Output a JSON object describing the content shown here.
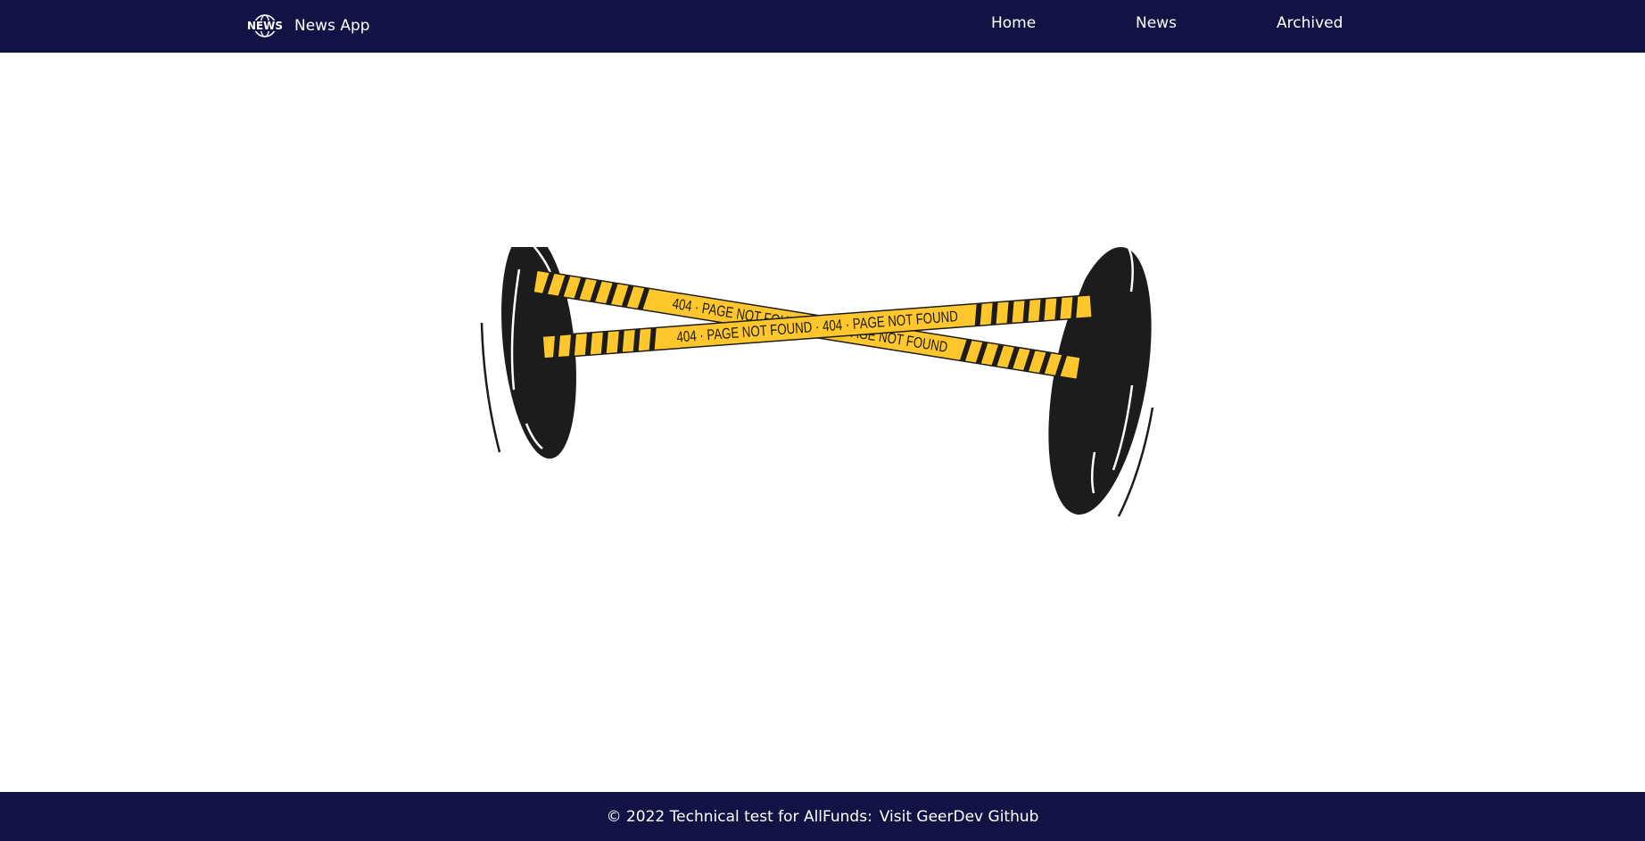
{
  "header": {
    "logo_icon": "news-globe-icon",
    "logo_text": "NEWS",
    "app_name": "News App",
    "nav": {
      "home": "Home",
      "news": "News",
      "archived": "Archived"
    }
  },
  "illustration": {
    "tape_text_a": "404 · PAGE NOT FOUND · 404 · PAGE NOT FOUND",
    "tape_text_b": "404 · PAGE NOT FOUND · 404 · PAGE NOT FOUND",
    "colors": {
      "tape": "#ffc72c",
      "post": "#1c1c1c"
    }
  },
  "footer": {
    "text": "© 2022 Technical test for AllFunds:",
    "link": "Visit GeerDev Github"
  },
  "colors": {
    "header_bg": "#111345",
    "footer_bg": "#111345"
  }
}
